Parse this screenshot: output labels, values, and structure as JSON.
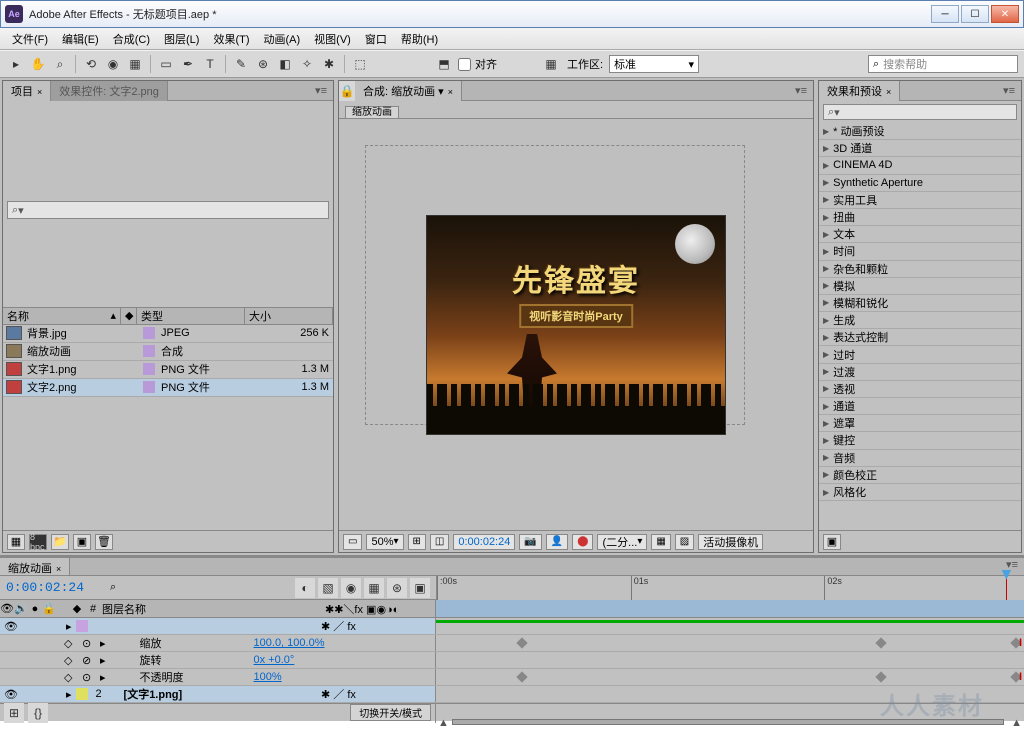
{
  "window": {
    "title": "Adobe After Effects - 无标题项目.aep *"
  },
  "menu": [
    "文件(F)",
    "编辑(E)",
    "合成(C)",
    "图层(L)",
    "效果(T)",
    "动画(A)",
    "视图(V)",
    "窗口",
    "帮助(H)"
  ],
  "toolbar": {
    "snap_label": "对齐",
    "workspace_label": "工作区:",
    "workspace_value": "标准",
    "search_placeholder": "搜索帮助"
  },
  "panels": {
    "project": {
      "tab1": "项目",
      "tab2": "效果控件: 文字2.png",
      "search_icon": "⌕",
      "columns": {
        "name": "名称",
        "label": "",
        "type": "类型",
        "size": "大小"
      },
      "items": [
        {
          "name": "背景.jpg",
          "type": "JPEG",
          "size": "256 K",
          "color": "#b99ad8",
          "icon": "img"
        },
        {
          "name": "缩放动画",
          "type": "合成",
          "size": "",
          "color": "#b99ad8",
          "icon": "comp"
        },
        {
          "name": "文字1.png",
          "type": "PNG 文件",
          "size": "1.3 M",
          "color": "#b99ad8",
          "icon": "png"
        },
        {
          "name": "文字2.png",
          "type": "PNG 文件",
          "size": "1.3 M",
          "color": "#b99ad8",
          "icon": "png"
        }
      ],
      "footer_bpc": "8 bpc"
    },
    "composition": {
      "tab": "合成: 缩放动画",
      "subtab": "缩放动画",
      "preview": {
        "big_text": "先锋盛宴",
        "sub_text": "视听影音时尚Party"
      },
      "footer": {
        "zoom": "50%",
        "time": "0:00:02:24",
        "res": "(二分...",
        "camera": "活动摄像机"
      }
    },
    "effects": {
      "tab": "效果和预设",
      "search_icon": "⌕",
      "items": [
        "* 动画预设",
        "3D 通道",
        "CINEMA 4D",
        "Synthetic Aperture",
        "实用工具",
        "扭曲",
        "文本",
        "时间",
        "杂色和颗粒",
        "模拟",
        "模糊和锐化",
        "生成",
        "表达式控制",
        "过时",
        "过渡",
        "透视",
        "通道",
        "遮罩",
        "键控",
        "音频",
        "颜色校正",
        "风格化"
      ]
    }
  },
  "timeline": {
    "tab": "缩放动画",
    "timecode": "0:00:02:24",
    "search_icon": "⌕",
    "ruler": [
      {
        "label": ":00s",
        "pos": 0
      },
      {
        "label": "01s",
        "pos": 33
      },
      {
        "label": "02s",
        "pos": 66
      }
    ],
    "header": {
      "layer_col": "图层名称"
    },
    "rows": [
      {
        "kind": "layer",
        "num": "",
        "name": "",
        "color": "#c7a2e0"
      },
      {
        "kind": "prop",
        "name": "缩放",
        "value": "100.0, 100.0%",
        "keys": [
          14,
          75,
          98
        ]
      },
      {
        "kind": "prop",
        "name": "旋转",
        "value": "0x +0.0°",
        "keys": []
      },
      {
        "kind": "prop",
        "name": "不透明度",
        "value": "100%",
        "keys": [
          14,
          75,
          98
        ]
      },
      {
        "kind": "layer",
        "num": "2",
        "name": "[文字1.png]",
        "color": "#e0e060"
      }
    ],
    "footer_toggle": "切换开关/模式"
  },
  "watermark": "人人素材"
}
